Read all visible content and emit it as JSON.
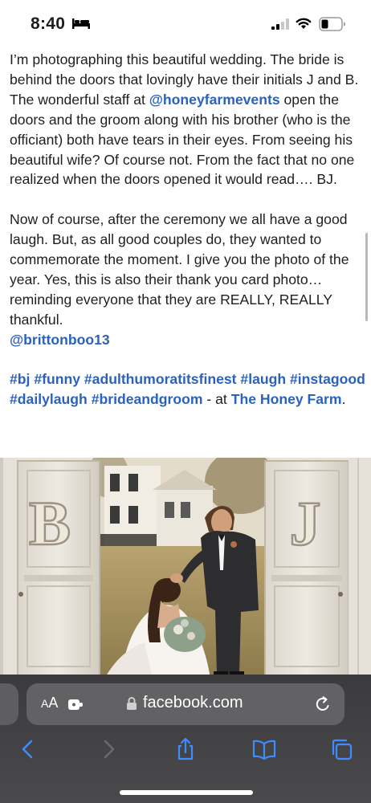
{
  "status_bar": {
    "time": "8:40",
    "icons": [
      "bed-icon",
      "signal-icon",
      "wifi-icon",
      "battery-icon"
    ]
  },
  "post": {
    "paragraph1": {
      "text_before": "I’m photographing this beautiful wedding. The bride is behind the doors that lovingly have their initials J and B. The wonderful staff at ",
      "mention": "@honeyfarmevents",
      "text_after": " open the doors and the groom along with his brother (who is the officiant) both have tears in their eyes. From seeing his beautiful wife? Of course not. From the fact that no one realized when the doors opened it would read…. BJ."
    },
    "paragraph2": "Now of course, after the ceremony we all have a good laugh. But, as all good couples do, they wanted to commemorate the moment. I give you the photo of the year. Yes, this is also their thank you card photo… reminding everyone that they are REALLY, REALLY thankful.",
    "mention2": "@brittonboo13",
    "hashtags": [
      "#bj",
      "#funny",
      "#adulthumoratitsfinest",
      "#laugh",
      "#instagood",
      "#dailylaugh",
      "#brideandgroom"
    ],
    "location_prefix": " - at ",
    "location": "The Honey Farm",
    "location_suffix": "."
  },
  "photo": {
    "door_left_letter": "B",
    "door_right_letter": "J"
  },
  "browser": {
    "aa_label_small": "A",
    "aa_label": "A",
    "url": "facebook.com",
    "toolbar": [
      "back-icon",
      "forward-icon",
      "share-icon",
      "bookmarks-icon",
      "tabs-icon"
    ]
  },
  "colors": {
    "link": "#2a62bd",
    "toolbar_icon": "#3f8cff",
    "chrome_bg": "#3b3b3d"
  }
}
